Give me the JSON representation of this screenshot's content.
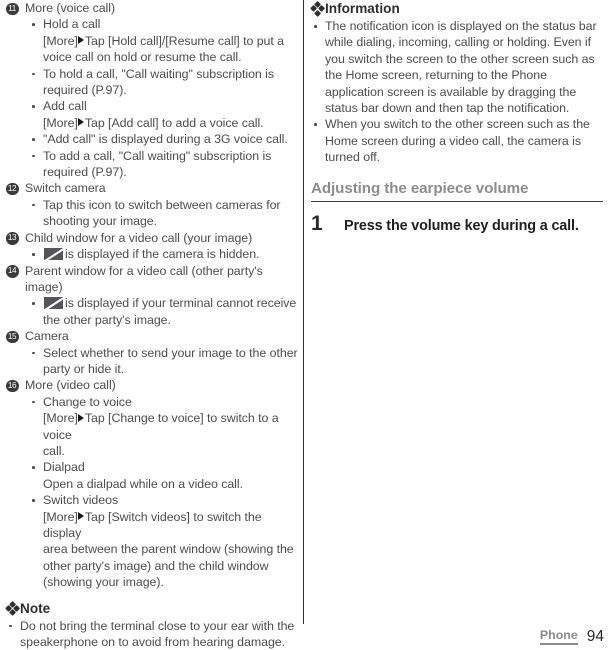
{
  "left_column": {
    "items": [
      {
        "number": "11",
        "label": "More (voice call)",
        "bullets": [
          {
            "lines": [
              "Hold a call",
              "[More]▶Tap [Hold call]/[Resume call] to put a",
              "voice call on hold or resume the call."
            ]
          },
          {
            "lines": [
              "To hold a call, \"Call waiting\" subscription is",
              "required (P.97)."
            ]
          },
          {
            "lines": [
              "Add call",
              "[More]▶Tap [Add call] to add a voice call."
            ]
          },
          {
            "lines": [
              "\"Add call\" is displayed during a 3G voice call."
            ]
          },
          {
            "lines": [
              "To add a call, \"Call waiting\" subscription is",
              "required (P.97)."
            ]
          }
        ]
      },
      {
        "number": "12",
        "label": "Switch camera",
        "bullets": [
          {
            "lines": [
              "Tap this icon to switch between cameras for",
              "shooting your image."
            ]
          }
        ]
      },
      {
        "number": "13",
        "label": "Child window for a video call (your image)",
        "bullets": [
          {
            "icon": "camera-off-icon",
            "lines": [
              "is displayed if the camera is hidden."
            ]
          }
        ]
      },
      {
        "number": "14",
        "label": "Parent window for a video call (other party's image)",
        "bullets": [
          {
            "icon": "camera-off-icon",
            "lines": [
              "is displayed if your terminal cannot receive",
              "the other party's image."
            ]
          }
        ]
      },
      {
        "number": "15",
        "label": "Camera",
        "bullets": [
          {
            "lines": [
              "Select whether to send your image to the other",
              "party or hide it."
            ]
          }
        ]
      },
      {
        "number": "16",
        "label": "More (video call)",
        "bullets": [
          {
            "lines": [
              "Change to voice",
              "[More]▶Tap [Change to voice] to switch to a voice",
              "call."
            ]
          },
          {
            "lines": [
              "Dialpad",
              "Open a dialpad while on a video call."
            ]
          },
          {
            "lines": [
              "Switch videos",
              "[More]▶Tap [Switch videos] to switch the display",
              "area between the parent window (showing the",
              "other party's image) and the child window",
              "(showing your image)."
            ]
          }
        ]
      }
    ],
    "note": {
      "heading": "Note",
      "bullets": [
        {
          "lines": [
            "Do not bring the terminal close to your ear with the",
            "speakerphone on to avoid from hearing damage."
          ]
        }
      ]
    }
  },
  "right_column": {
    "information": {
      "heading": "Information",
      "bullets": [
        {
          "lines": [
            "The notification icon is displayed on the status bar",
            "while dialing, incoming, calling or holding. Even if",
            "you switch the screen to the other screen such as the",
            "Home screen, returning to the Phone application",
            "screen is available by dragging the status bar down",
            "and then tap the notification."
          ]
        },
        {
          "lines": [
            "When you switch to the other screen such as the",
            "Home screen during a video call, the camera is",
            "turned off."
          ]
        }
      ]
    },
    "section": {
      "heading": "Adjusting the earpiece volume",
      "steps": [
        {
          "number": "1",
          "text": "Press the volume key during a call."
        }
      ]
    }
  },
  "footer": {
    "chapter": "Phone",
    "page": "94"
  },
  "colors": {
    "body_text": "#4d4d4d",
    "heading_dark": "#2e2e2e",
    "section_heading_gray": "#8c8c8c",
    "rule": "#3a3a3a",
    "divider": "#2e2e33",
    "circle_badge": "#3a3a3a",
    "icon_fill": "#555558",
    "footer_chapter": "#8a8a8a",
    "footer_page": "#2b2b2b"
  }
}
